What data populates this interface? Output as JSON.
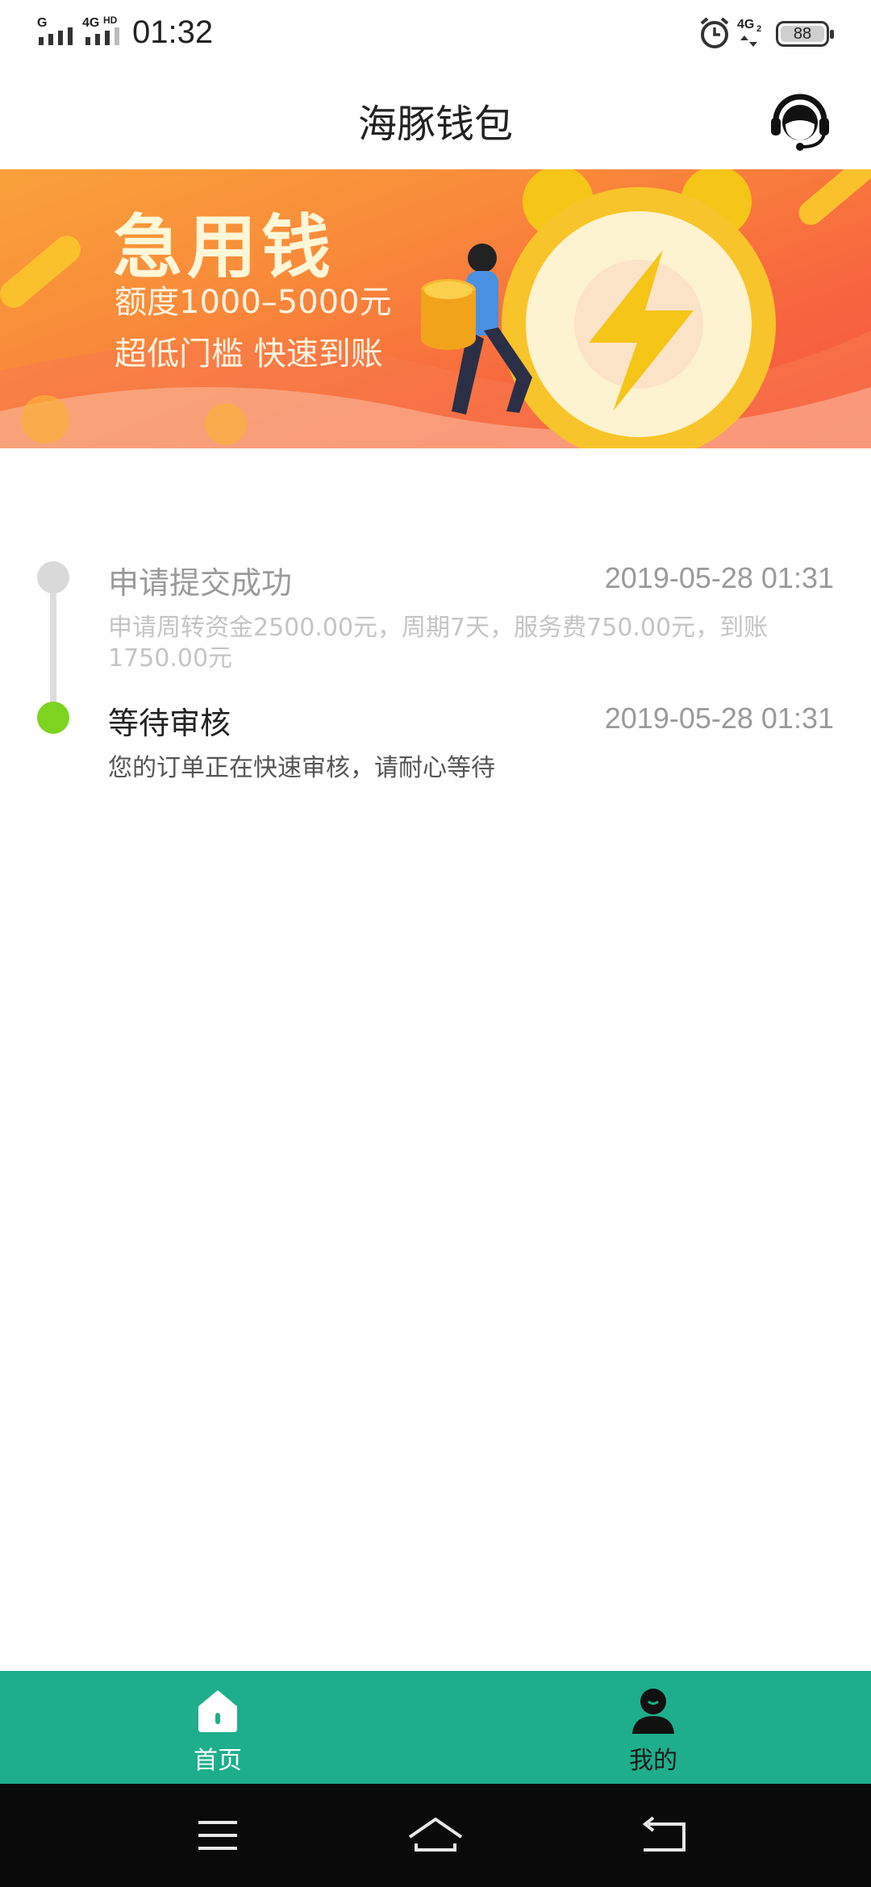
{
  "status_bar": {
    "sim1_label": "G",
    "sim2_label": "4G",
    "sim2_sup": "HD",
    "time": "01:32",
    "network2_label": "4G",
    "network2_sub": "2",
    "battery": "88",
    "icons": [
      "signal-icon",
      "alarm-icon",
      "battery-icon"
    ]
  },
  "header": {
    "title": "海豚钱包",
    "support_icon": "customer-service-icon"
  },
  "banner": {
    "title": "急用钱",
    "line1": "额度1000–5000元",
    "line2": "超低门槛 快速到账",
    "colors": {
      "start": "#f9a13a",
      "end": "#f4543f"
    }
  },
  "timeline": {
    "steps": [
      {
        "title": "申请提交成功",
        "time": "2019-05-28 01:31",
        "desc": "申请周转资金2500.00元，周期7天，服务费750.00元，到账1750.00元",
        "state": "done",
        "dot_color": "#d9d9d9"
      },
      {
        "title": "等待审核",
        "time": "2019-05-28 01:31",
        "desc": "您的订单正在快速审核，请耐心等待",
        "state": "current",
        "dot_color": "#7ed321"
      }
    ]
  },
  "bottom_nav": {
    "color": "#1eae8b",
    "items": [
      {
        "label": "首页",
        "icon": "home-icon",
        "active": true
      },
      {
        "label": "我的",
        "icon": "user-icon",
        "active": false
      }
    ]
  },
  "system_nav": {
    "icons": [
      "menu-icon",
      "home-outline-icon",
      "back-icon"
    ]
  }
}
